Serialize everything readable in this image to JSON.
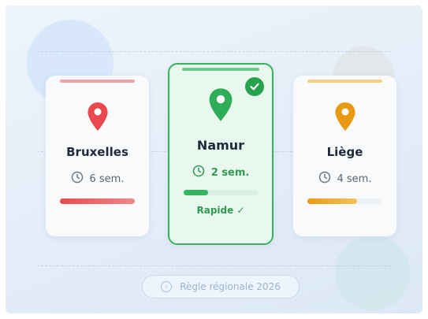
{
  "cards": [
    {
      "city": "Bruxelles",
      "duration": "6 sem.",
      "accent": "#e84a4f",
      "progress": 1.0,
      "selected": false,
      "pin_icon": "map-pin-icon",
      "clock_icon": "clock-icon"
    },
    {
      "city": "Namur",
      "duration": "2 sem.",
      "accent": "#2fae5a",
      "progress": 0.33,
      "selected": true,
      "badge": "Rapide ✓",
      "pin_icon": "map-pin-icon",
      "clock_icon": "clock-icon",
      "selected_icon": "checkmark-circle-icon"
    },
    {
      "city": "Liège",
      "duration": "4 sem.",
      "accent": "#e89a12",
      "progress": 0.66,
      "selected": false,
      "pin_icon": "map-pin-icon",
      "clock_icon": "clock-icon"
    }
  ],
  "footer": {
    "label": "Règle régionale 2026",
    "icon": "info-icon"
  }
}
